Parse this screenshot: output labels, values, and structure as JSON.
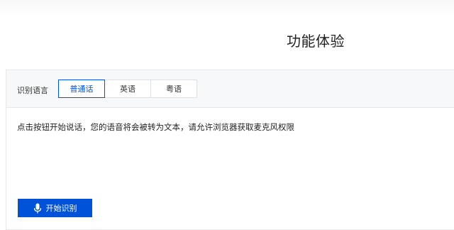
{
  "page": {
    "title": "功能体验"
  },
  "language": {
    "label": "识别语言",
    "tabs": [
      {
        "label": "普通话",
        "active": true
      },
      {
        "label": "英语",
        "active": false
      },
      {
        "label": "粤语",
        "active": false
      }
    ]
  },
  "result": {
    "hint": "点击按钮开始说话，您的语音将会被转为文本，请允许浏览器获取麦克风权限"
  },
  "controls": {
    "start_label": "开始识别",
    "start_icon": "microphone-icon"
  },
  "colors": {
    "accent": "#0052d9"
  }
}
